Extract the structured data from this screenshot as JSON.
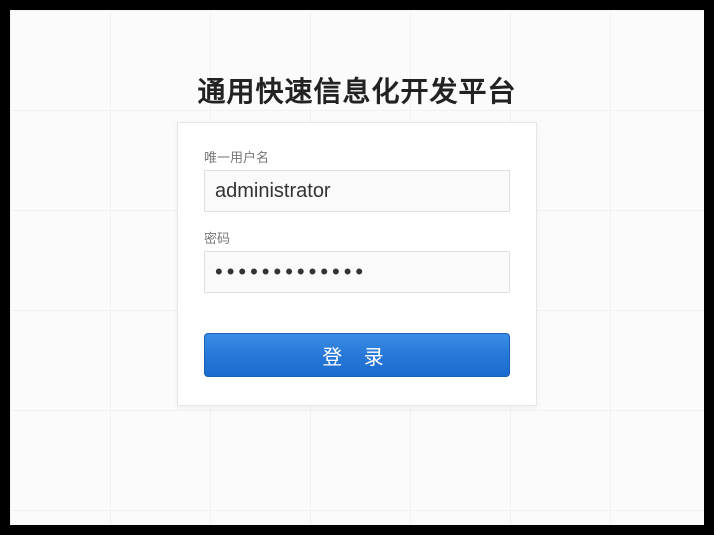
{
  "title": "通用快速信息化开发平台",
  "form": {
    "username": {
      "label": "唯一用户名",
      "value": "administrator"
    },
    "password": {
      "label": "密码",
      "value": "•••••••••••••"
    },
    "submit_label": "登 录"
  }
}
